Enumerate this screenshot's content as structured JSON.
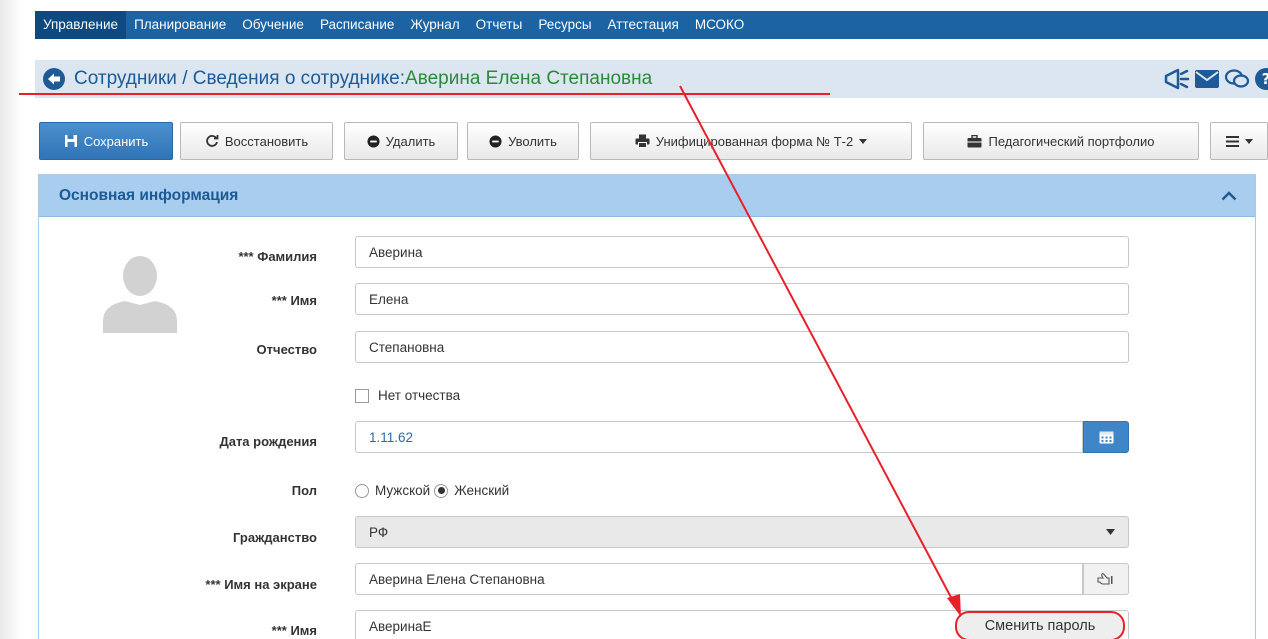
{
  "nav": {
    "items": [
      {
        "label": "Управление",
        "active": true
      },
      {
        "label": "Планирование",
        "active": false
      },
      {
        "label": "Обучение",
        "active": false
      },
      {
        "label": "Расписание",
        "active": false
      },
      {
        "label": "Журнал",
        "active": false
      },
      {
        "label": "Отчеты",
        "active": false
      },
      {
        "label": "Ресурсы",
        "active": false
      },
      {
        "label": "Аттестация",
        "active": false
      },
      {
        "label": "МСОКО",
        "active": false
      }
    ]
  },
  "title": {
    "path": "Сотрудники / Сведения о сотруднике: ",
    "name": "Аверина Елена Степановна"
  },
  "toolbar": {
    "save": "Сохранить",
    "restore": "Восстановить",
    "delete": "Удалить",
    "dismiss": "Уволить",
    "form": "Унифицированная форма № Т-2",
    "portfolio": "Педагогический портфолио"
  },
  "panel": {
    "title": "Основная информация"
  },
  "form": {
    "last_name_label": "*** Фамилия",
    "last_name": "Аверина",
    "first_name_label": "*** Имя",
    "first_name": "Елена",
    "patronymic_label": "Отчество",
    "patronymic": "Степановна",
    "no_patronymic": "Нет отчества",
    "birth_date_label": "Дата рождения",
    "birth_date": "1.11.62",
    "gender_label": "Пол",
    "gender_male": "Мужской",
    "gender_female": "Женский",
    "gender_selected": "Женский",
    "citizenship_label": "Гражданство",
    "citizenship": "РФ",
    "screen_name_label": "*** Имя на экране",
    "screen_name": "Аверина Елена Степановна",
    "login_label": "*** Имя",
    "login": "АверинаЕ",
    "change_password": "Сменить пароль"
  },
  "colors": {
    "nav_bg": "#1c63a3",
    "title_bg": "#dbe6f1",
    "title_name": "#2a8a3a",
    "annotation": "#e8202a",
    "panel_header": "#a8cdee"
  }
}
